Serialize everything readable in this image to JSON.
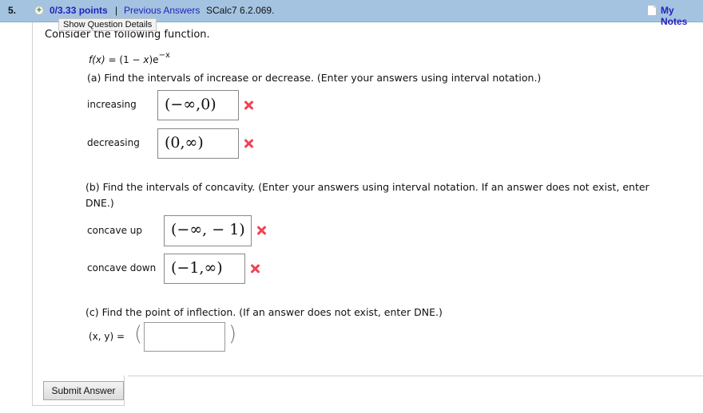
{
  "header": {
    "question_number": "5.",
    "points": "0/3.33 points",
    "separator": "|",
    "previous_answers": "Previous Answers",
    "reference": "SCalc7 6.2.069.",
    "my_notes": "My Notes",
    "tooltip": "Show Question Details"
  },
  "question": {
    "intro": "Consider the following function.",
    "function": {
      "lhs": "f(x)",
      "eq": " = (1 − ",
      "x": "x",
      "close": ")e",
      "exp": "−x"
    },
    "part_a": {
      "prompt": "(a) Find the intervals of increase or decrease. (Enter your answers using interval notation.)",
      "increasing_label": "increasing",
      "increasing_value": "(−∞,0)",
      "increasing_status": "incorrect",
      "decreasing_label": "decreasing",
      "decreasing_value": "(0,∞)",
      "decreasing_status": "incorrect"
    },
    "part_b": {
      "prompt_line1": "(b) Find the intervals of concavity. (Enter your answers using interval notation. If an answer does not exist, enter",
      "prompt_line2": "DNE.)",
      "concave_up_label": "concave up",
      "concave_up_value": "(−∞, − 1)",
      "concave_up_status": "incorrect",
      "concave_down_label": "concave down",
      "concave_down_value": "(−1,∞)",
      "concave_down_status": "incorrect"
    },
    "part_c": {
      "prompt": "(c) Find the point of inflection. (If an answer does not exist, enter DNE.)",
      "label": "(x, y) =",
      "open_paren": "(",
      "close_paren": ")",
      "value": ""
    }
  },
  "submit_label": "Submit Answer",
  "colors": {
    "header_bg": "#a4c3e0",
    "link": "#2222bb",
    "incorrect": "#ee4455"
  }
}
